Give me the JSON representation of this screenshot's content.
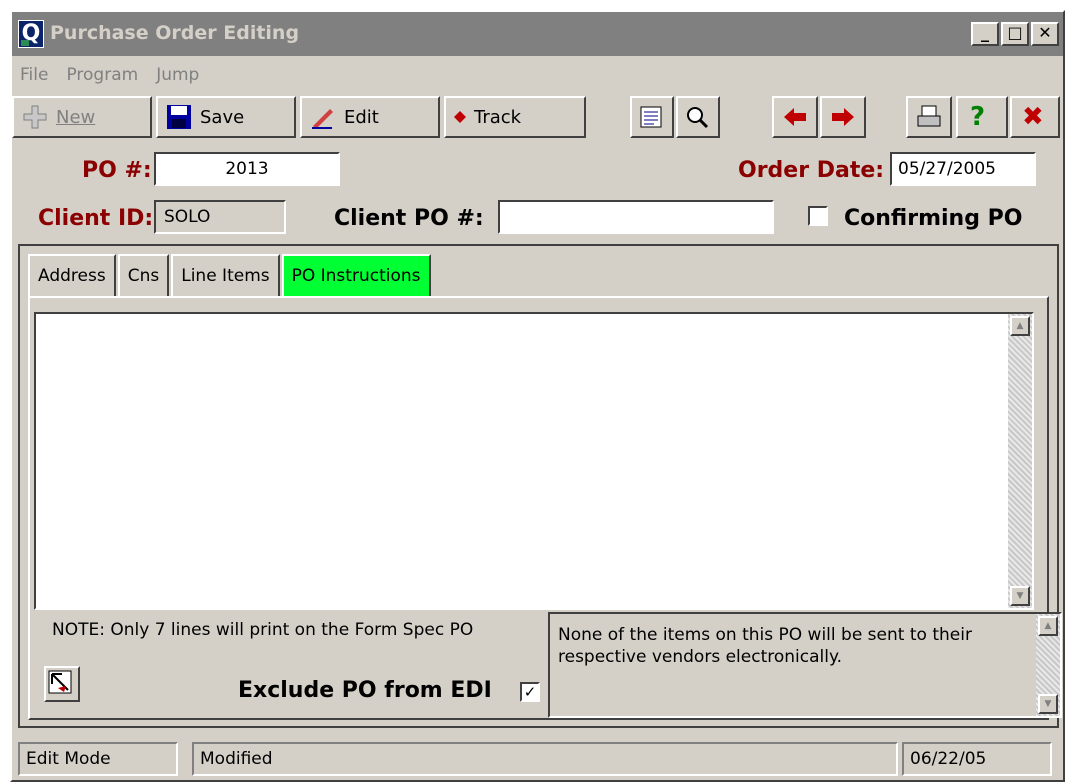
{
  "window": {
    "title": "Purchase Order Editing",
    "app_icon_letter": "Q",
    "controls": {
      "minimize": "_",
      "maximize": "□",
      "close": "✕"
    }
  },
  "menu": [
    "File",
    "Program",
    "Jump"
  ],
  "toolbar": {
    "new_label": "New",
    "save_label": "Save",
    "edit_label": "Edit",
    "track_label": "Track",
    "icons": [
      "new-icon",
      "save-icon",
      "edit-pencil-icon",
      "track-diamond-icon",
      "notes-icon",
      "search-magnifier-icon",
      "previous-arrow-icon",
      "next-arrow-icon",
      "print-icon",
      "help-icon",
      "close-x-icon"
    ]
  },
  "header": {
    "po_label": "PO #:",
    "po_value": "2013",
    "order_date_label": "Order Date:",
    "order_date_value": "05/27/2005",
    "client_id_label": "Client ID:",
    "client_id_value": "SOLO",
    "client_po_label": "Client PO #:",
    "client_po_value": "",
    "confirming_label": "Confirming PO",
    "confirming_checked": false
  },
  "tabs": [
    {
      "label": "Address",
      "active": false
    },
    {
      "label": "Cns",
      "active": false
    },
    {
      "label": "Line Items",
      "active": false
    },
    {
      "label": "PO Instructions",
      "active": true
    }
  ],
  "instructions": {
    "text": "",
    "note": "NOTE:  Only 7 lines will print on the Form Spec PO",
    "info": "None of the items on this PO will be sent to their respective vendors electronically.",
    "exclude_label": "Exclude PO from EDI",
    "exclude_checked": true,
    "check_glyph": "✓"
  },
  "status": {
    "mode": "Edit Mode",
    "state": "Modified",
    "date": "06/22/05"
  },
  "colors": {
    "dark_red": "#8b0000",
    "active_tab": "#00ff33",
    "face": "#d4d0c8"
  }
}
